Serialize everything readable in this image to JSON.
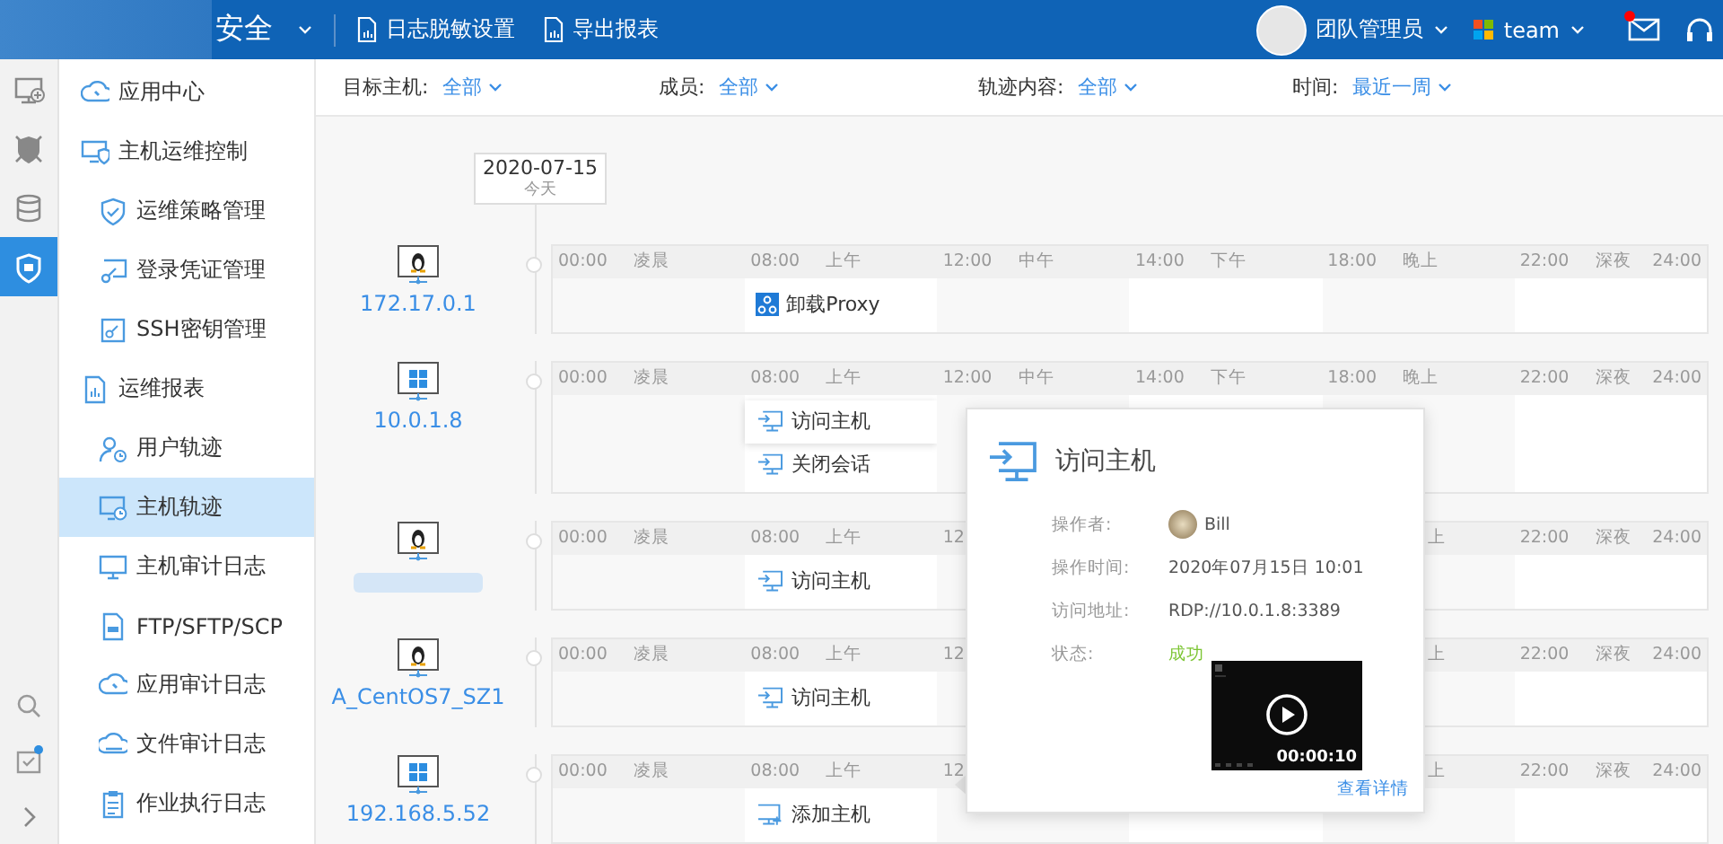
{
  "topbar": {
    "product": "安全",
    "actions": [
      "日志脱敏设置",
      "导出报表"
    ],
    "user": "团队管理员",
    "team": "team",
    "mail_unread": true
  },
  "rail": [
    {
      "selected": false
    },
    {
      "selected": false
    },
    {
      "selected": false
    },
    {
      "selected": true
    }
  ],
  "rail_bottom": [
    {
      "badge": false
    },
    {
      "badge": true
    }
  ],
  "sidebar": {
    "items": [
      {
        "label": "应用中心",
        "selected": false
      },
      {
        "label": "主机运维控制",
        "selected": false,
        "children": [
          {
            "label": "运维策略管理",
            "selected": false
          },
          {
            "label": "登录凭证管理",
            "selected": false
          },
          {
            "label": "SSH密钥管理",
            "selected": false
          }
        ]
      },
      {
        "label": "运维报表",
        "selected": false,
        "children": [
          {
            "label": "用户轨迹",
            "selected": false
          },
          {
            "label": "主机轨迹",
            "selected": true
          },
          {
            "label": "主机审计日志",
            "selected": false
          },
          {
            "label": "FTP/SFTP/SCP",
            "selected": false
          },
          {
            "label": "应用审计日志",
            "selected": false
          },
          {
            "label": "文件审计日志",
            "selected": false
          },
          {
            "label": "作业执行日志",
            "selected": false
          }
        ]
      }
    ]
  },
  "filters": [
    {
      "label": "目标主机:",
      "value": "全部"
    },
    {
      "label": "成员:",
      "value": "全部"
    },
    {
      "label": "轨迹内容:",
      "value": "全部"
    },
    {
      "label": "时间:",
      "value": "最近一周"
    }
  ],
  "date": {
    "date": "2020-07-15",
    "caption": "今天"
  },
  "hosts": [
    {
      "label": "172.17.0.1",
      "kind": "linux",
      "redacted": false,
      "end": "24:00",
      "segments": [
        {
          "time": "00:00",
          "period": "凌晨"
        },
        {
          "time": "08:00",
          "period": "上午",
          "events": [
            {
              "label": "卸载Proxy",
              "kind": "proxy",
              "selected": false
            }
          ]
        },
        {
          "time": "12:00",
          "period": "中午"
        },
        {
          "time": "14:00",
          "period": "下午"
        },
        {
          "time": "18:00",
          "period": "晚上"
        },
        {
          "time": "22:00",
          "period": "深夜"
        }
      ]
    },
    {
      "label": "10.0.1.8",
      "kind": "windows",
      "redacted": false,
      "end": "24:00",
      "segments": [
        {
          "time": "00:00",
          "period": "凌晨"
        },
        {
          "time": "08:00",
          "period": "上午",
          "events": [
            {
              "label": "访问主机",
              "kind": "login",
              "selected": true
            },
            {
              "label": "关闭会话",
              "kind": "login",
              "selected": false
            }
          ]
        },
        {
          "time": "12:00",
          "period": "中午"
        },
        {
          "time": "14:00",
          "period": "下午"
        },
        {
          "time": "18:00",
          "period": "晚上"
        },
        {
          "time": "22:00",
          "period": "深夜"
        }
      ]
    },
    {
      "kind": "linux",
      "redacted": true,
      "end": "24:00",
      "segments": [
        {
          "time": "00:00",
          "period": "凌晨"
        },
        {
          "time": "08:00",
          "period": "上午",
          "events": [
            {
              "label": "访问主机",
              "kind": "login",
              "selected": false
            }
          ]
        },
        {
          "time": "12"
        }
      ],
      "tail_segments": [
        {
          "period": "上"
        },
        {
          "time": "22:00",
          "period": "深夜"
        }
      ]
    },
    {
      "label": "A_CentOS7_SZ1",
      "kind": "linux",
      "redacted": false,
      "end": "24:00",
      "segments": [
        {
          "time": "00:00",
          "period": "凌晨"
        },
        {
          "time": "08:00",
          "period": "上午",
          "events": [
            {
              "label": "访问主机",
              "kind": "login",
              "selected": false
            }
          ]
        },
        {
          "time": "12"
        }
      ],
      "tail_segments": [
        {
          "period": "上"
        },
        {
          "time": "22:00",
          "period": "深夜"
        }
      ]
    },
    {
      "label": "192.168.5.52",
      "kind": "windows",
      "redacted": false,
      "end": "24:00",
      "segments": [
        {
          "time": "00:00",
          "period": "凌晨"
        },
        {
          "time": "08:00",
          "period": "上午",
          "events": [
            {
              "label": "添加主机",
              "kind": "add",
              "selected": false
            }
          ]
        },
        {
          "time": "12"
        }
      ],
      "tail_segments": [
        {
          "period": "上"
        },
        {
          "time": "22:00",
          "period": "深夜"
        }
      ]
    }
  ],
  "detail": {
    "title": "访问主机",
    "fields": [
      {
        "label": "操作者:",
        "value": "Bill",
        "kind": "user"
      },
      {
        "label": "操作时间:",
        "value": "2020年07月15日 10:01",
        "kind": "text"
      },
      {
        "label": "访问地址:",
        "value": "RDP://10.0.1.8:3389",
        "kind": "text"
      },
      {
        "label": "状态:",
        "value": "成功",
        "kind": "status"
      }
    ],
    "video": {
      "duration": "00:00:10"
    },
    "link": "查看详情"
  }
}
